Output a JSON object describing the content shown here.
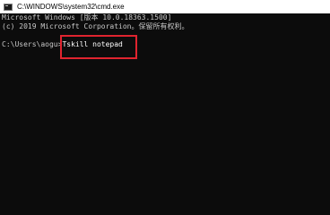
{
  "window": {
    "title": "C:\\WINDOWS\\system32\\cmd.exe"
  },
  "console": {
    "lines": [
      "Microsoft Windows [版本 10.0.18363.1500]",
      "(c) 2019 Microsoft Corporation。保留所有权利。"
    ],
    "prompt": "C:\\Users\\aogu>",
    "command": "Tskill notepad"
  },
  "highlight": {
    "color": "#e0242f"
  }
}
